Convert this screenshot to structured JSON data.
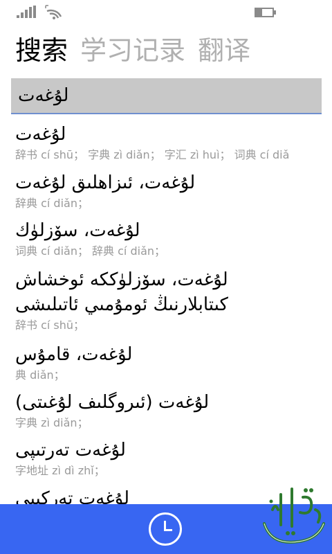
{
  "pivot": {
    "tabs": [
      {
        "label": "搜索"
      },
      {
        "label": "学习记录"
      },
      {
        "label": "翻译"
      }
    ]
  },
  "search": {
    "value": "لۇغەت"
  },
  "results": [
    {
      "word": "لۇغەت",
      "meta": "辞书 cí shū； 字典 zì diǎn； 字汇 zì huì； 词典 cí diǎ"
    },
    {
      "word": "لۇغەت، ئىزاھلىق لۇغەت",
      "meta": "辞典 cí diǎn；"
    },
    {
      "word": "لۇغەت، سۆزلۈك",
      "meta": "词典 cí diǎn； 辞典 cí diǎn；"
    },
    {
      "word": "لۇغەت، سۆزلۈككە ئوخشاش",
      "word2": "كىتابلارنىڭ ئومۇمىي ئاتىلىشى",
      "meta": "辞书 cí shū；"
    },
    {
      "word": "لۇغەت، قامۇس",
      "meta": "典 diǎn；"
    },
    {
      "word": "لۇغەت (ئىروگلىف لۇغىتى)",
      "meta": "字典 zì diǎn；"
    },
    {
      "word": "لۇغەت تەرتىپى",
      "meta": "字地址 zì dì zhǐ；"
    },
    {
      "word": "لۇغەت تەركىبى"
    }
  ],
  "colors": {
    "app_bar": "#3866f2",
    "search_bg": "#c8c8c8",
    "search_underline": "#6f8fcf",
    "inactive_tab": "#b0b0b0",
    "meta_text": "#9a9a9a",
    "logo_green": "#2f7a2f"
  },
  "icons": {
    "signal": "signal-strength-icon",
    "wifi": "wifi-icon",
    "battery": "battery-icon",
    "history": "clock-icon",
    "logo": "app-logo-calligraphy"
  },
  "status": {
    "battery_level": 0.35
  }
}
